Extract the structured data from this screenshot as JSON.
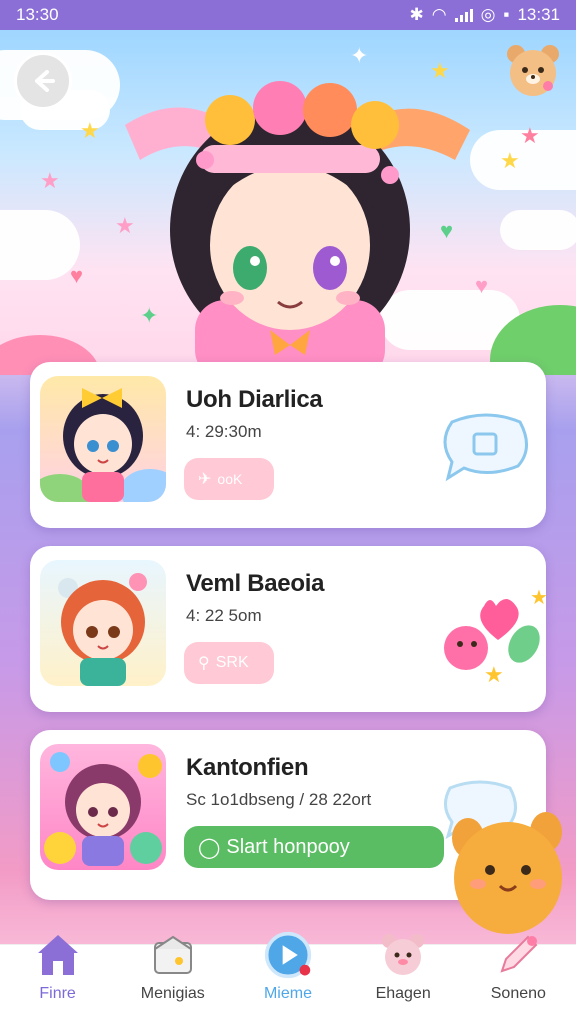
{
  "status_bar": {
    "time_left": "13:30",
    "time_right": "13:31"
  },
  "header": {
    "back_icon": "arrow-left-icon",
    "pet_icon": "bear-face-icon"
  },
  "cards": [
    {
      "title": "Uoh Diarlica",
      "subtitle": "4: 29:30m",
      "chip_label": "ooK",
      "chip_icon": "pin-icon",
      "deco_icon": "chat-bubble-icon"
    },
    {
      "title": "Veml Baeoia",
      "subtitle": "4: 22 5om",
      "chip_label": "SRK",
      "chip_icon": "location-icon",
      "deco_icon": "heart-flower-icon"
    },
    {
      "title": "Kantonfien",
      "subtitle": "Sc 1o1dbseng / 28 22ort",
      "chip_label": "Slart honpooy",
      "chip_icon": "chat-icon",
      "deco_icon": "chat-bubble-icon"
    }
  ],
  "nav": [
    {
      "label": "Finre",
      "icon": "home-icon"
    },
    {
      "label": "Menigias",
      "icon": "box-icon"
    },
    {
      "label": "Mieme",
      "icon": "play-icon"
    },
    {
      "label": "Ehagen",
      "icon": "bear-icon"
    },
    {
      "label": "Soneno",
      "icon": "pencil-icon"
    }
  ],
  "colors": {
    "accent": "#7b6ad8",
    "status_bar": "#8b6fd6",
    "green": "#5bbd63",
    "pink_chip": "#ffc9d6"
  }
}
